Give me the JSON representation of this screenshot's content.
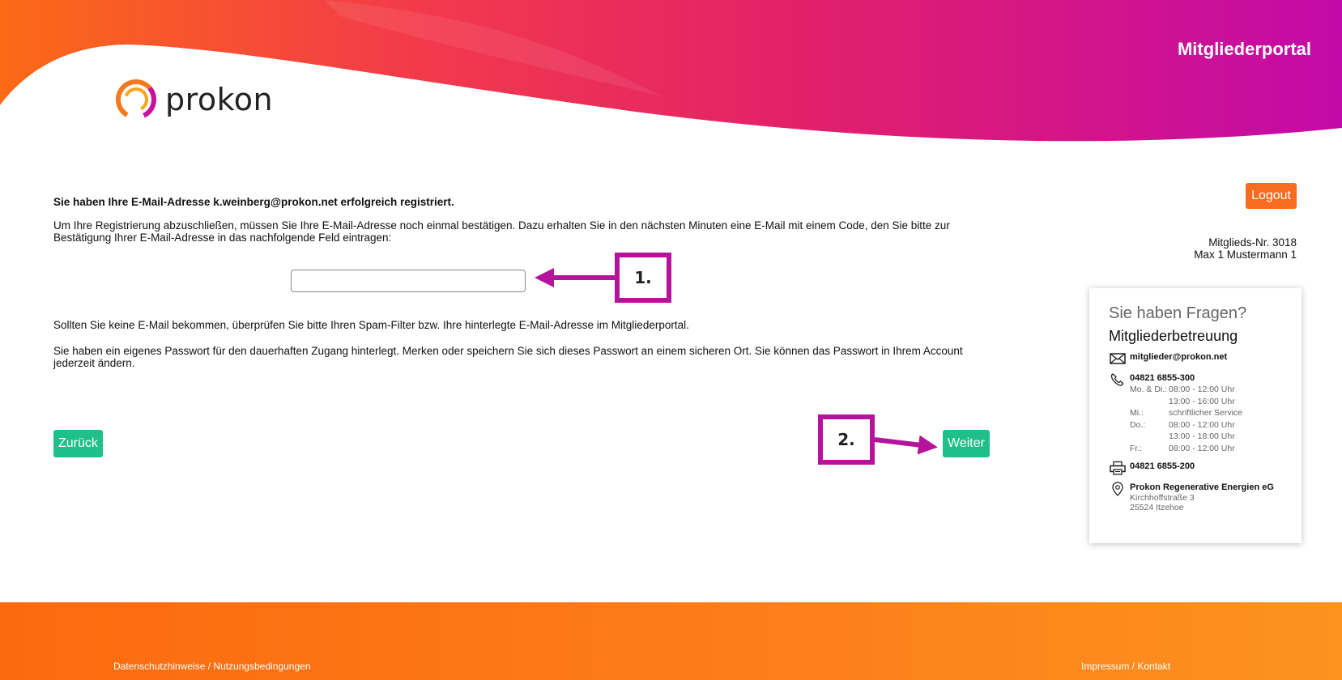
{
  "header": {
    "logo_text": "prokon",
    "portal_title": "Mitgliederportal"
  },
  "main": {
    "headline": "Sie haben Ihre E-Mail-Adresse k.weinberg@prokon.net erfolgreich registriert.",
    "instruction": "Um Ihre Registrierung abzuschließen, müssen Sie Ihre E-Mail-Adresse noch einmal bestätigen. Dazu erhalten Sie in den nächsten Minuten eine E-Mail mit einem Code, den Sie bitte zur Bestätigung Ihrer E-Mail-Adresse in das nachfolgende Feld eintragen:",
    "code_input": {
      "value": "",
      "placeholder": ""
    },
    "spam_hint": "Sollten Sie keine E-Mail bekommen, überprüfen Sie bitte Ihren Spam-Filter bzw. Ihre hinterlegte E-Mail-Adresse im Mitgliederportal.",
    "password_hint": "Sie haben ein eigenes Passwort für den dauerhaften Zugang hinterlegt. Merken oder speichern Sie sich dieses Passwort an einem sicheren Ort. Sie können das Passwort in Ihrem Account jederzeit ändern.",
    "back_label": "Zurück",
    "next_label": "Weiter"
  },
  "annotations": {
    "step1": "1.",
    "step2": "2.",
    "color": "#b5139c"
  },
  "account": {
    "logout_label": "Logout",
    "member_number": "Mitglieds-Nr. 3018",
    "member_name": "Max 1 Mustermann 1"
  },
  "help": {
    "title": "Sie haben Fragen?",
    "subtitle": "Mitgliederbetreuung",
    "email": "mitglieder@prokon.net",
    "phone": "04821 6855-300",
    "hours": [
      {
        "day": "Mo. & Di.:",
        "time": "08:00 - 12:00 Uhr"
      },
      {
        "day": "",
        "time": "13:00 - 16:00 Uhr"
      },
      {
        "day": "Mi.:",
        "time": "schriftlicher Service"
      },
      {
        "day": "Do.:",
        "time": "08:00 - 12:00 Uhr"
      },
      {
        "day": "",
        "time": "13:00 - 18:00 Uhr"
      },
      {
        "day": "Fr.:",
        "time": "08:00 - 12:00 Uhr"
      }
    ],
    "fax": "04821 6855-200",
    "company": "Prokon Regenerative Energien eG",
    "street": "Kirchhoffstraße 3",
    "city": "25524 Itzehoe"
  },
  "footer": {
    "privacy_link": "Datenschutzhinweise / Nutzungsbedingungen",
    "imprint_link": "Impressum / Kontakt"
  },
  "colors": {
    "brand_orange": "#f96b1e",
    "brand_magenta": "#c8109e",
    "button_green": "#1fbf8a"
  }
}
